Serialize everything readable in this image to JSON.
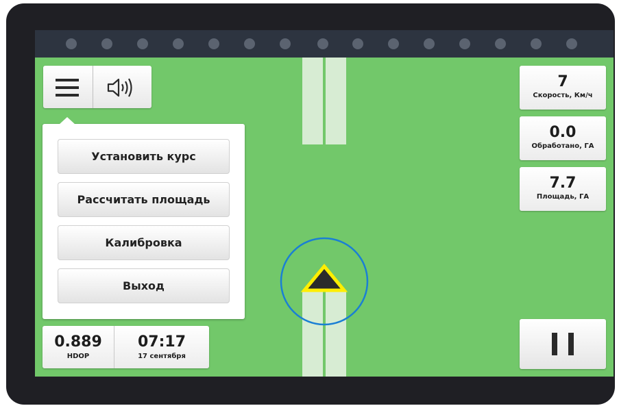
{
  "menu": {
    "items": [
      {
        "label": "Установить курс"
      },
      {
        "label": "Рассчитать площадь"
      },
      {
        "label": "Калибровка"
      },
      {
        "label": "Выход"
      }
    ]
  },
  "stats": {
    "speed": {
      "value": "7",
      "label": "Скорость, Км/ч"
    },
    "processed": {
      "value": "0.0",
      "label": "Обработано, ГА"
    },
    "area": {
      "value": "7.7",
      "label": "Площадь, ГА"
    }
  },
  "status": {
    "hdop": {
      "value": "0.889",
      "label": "HDOP"
    },
    "time": {
      "value": "07:17",
      "date": "17 сентября"
    }
  },
  "colors": {
    "field": "#72c86a",
    "track": "#d7ecd3",
    "topbar": "#2d3440",
    "marker_ring": "#1a7fd4",
    "marker_outline": "#ffee00",
    "marker_fill": "#2b2b2b"
  },
  "icons": {
    "menu": "hamburger-icon",
    "sound": "speaker-icon",
    "pause": "pause-icon",
    "vehicle": "vehicle-marker"
  }
}
